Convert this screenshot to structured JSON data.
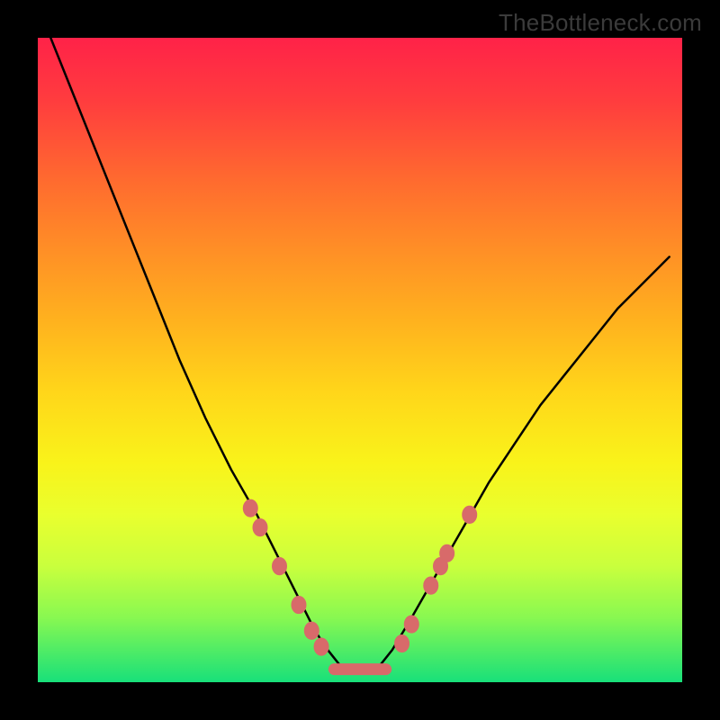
{
  "watermark": "TheBottleneck.com",
  "chart_data": {
    "type": "line",
    "title": "",
    "xlabel": "",
    "ylabel": "",
    "xlim": [
      0,
      100
    ],
    "ylim": [
      0,
      100
    ],
    "grid": false,
    "legend": false,
    "series": [
      {
        "name": "curve",
        "x": [
          2,
          6,
          10,
          14,
          18,
          22,
          26,
          30,
          34,
          38,
          41,
          43,
          45,
          47,
          49,
          51,
          53,
          55,
          58,
          62,
          66,
          70,
          74,
          78,
          82,
          86,
          90,
          94,
          98
        ],
        "y": [
          100,
          90,
          80,
          70,
          60,
          50,
          41,
          33,
          26,
          18,
          12,
          8,
          5,
          2.5,
          2,
          2,
          2.5,
          5,
          10,
          17,
          24,
          31,
          37,
          43,
          48,
          53,
          58,
          62,
          66
        ]
      }
    ],
    "markers": {
      "left": [
        {
          "x": 33,
          "y": 27
        },
        {
          "x": 34.5,
          "y": 24
        },
        {
          "x": 37.5,
          "y": 18
        },
        {
          "x": 40.5,
          "y": 12
        },
        {
          "x": 42.5,
          "y": 8
        },
        {
          "x": 44,
          "y": 5.5
        }
      ],
      "flat": [
        {
          "x": 46,
          "y": 2
        },
        {
          "x": 54,
          "y": 2
        }
      ],
      "right": [
        {
          "x": 56.5,
          "y": 6
        },
        {
          "x": 58,
          "y": 9
        },
        {
          "x": 61,
          "y": 15
        },
        {
          "x": 62.5,
          "y": 18
        },
        {
          "x": 63.5,
          "y": 20
        },
        {
          "x": 67,
          "y": 26
        }
      ]
    },
    "marker_color": "#d86a6a",
    "marker_radius_px": 8,
    "gradient_colors_top_to_bottom": [
      "#ff2248",
      "#ff3d3e",
      "#ff6a2f",
      "#ff8f26",
      "#ffb21e",
      "#ffd61a",
      "#f9f31a",
      "#e9ff2e",
      "#c9ff3d",
      "#88f851",
      "#18e07a"
    ]
  }
}
